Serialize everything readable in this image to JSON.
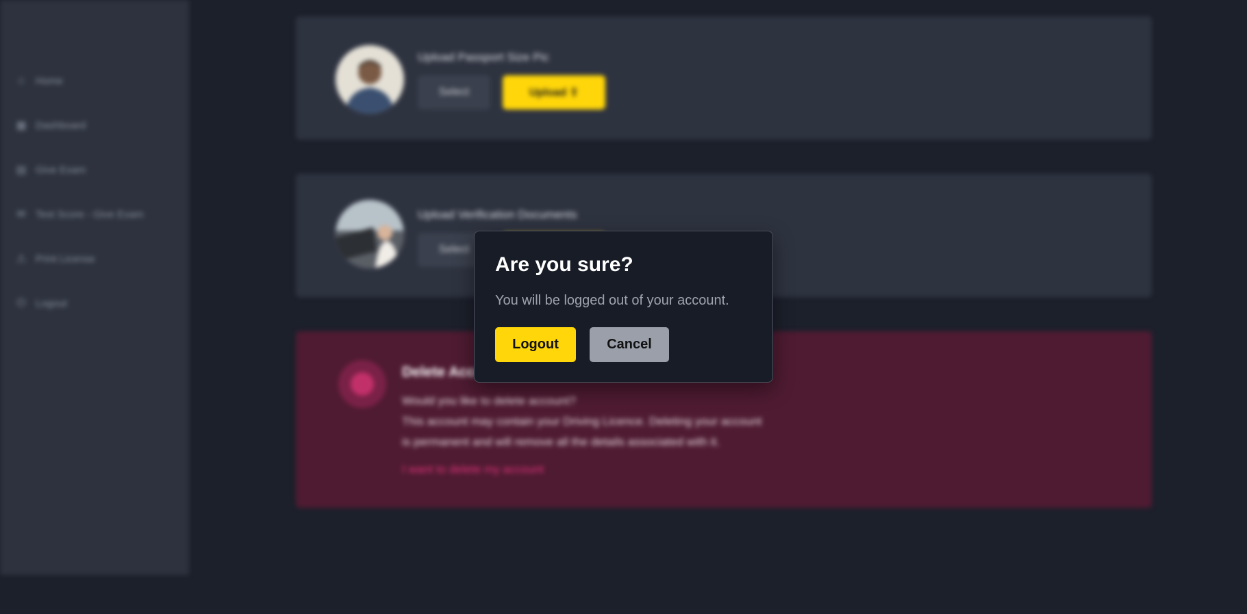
{
  "sidebar": {
    "items": [
      {
        "label": "Home",
        "icon": "home-icon"
      },
      {
        "label": "Dashboard",
        "icon": "dashboard-icon"
      },
      {
        "label": "Give Exam",
        "icon": "exam-icon"
      },
      {
        "label": "Test Score - Give Exam",
        "icon": "score-icon"
      },
      {
        "label": "Print License",
        "icon": "license-icon"
      },
      {
        "label": "Logout",
        "icon": "logout-icon"
      }
    ]
  },
  "passport_card": {
    "title": "Upload Passport Size Pic",
    "select_label": "Select",
    "upload_label": "Upload ⇪"
  },
  "verify_card": {
    "title": "Upload Verification Documents",
    "select_label": "Select"
  },
  "delete_card": {
    "title": "Delete Account",
    "question": "Would you like to delete account?",
    "line1": "This account may contain your Driving Licence. Deleting your account",
    "line2": "is permanent and will remove all the details associated with it.",
    "link": "I want to delete my account"
  },
  "modal": {
    "title": "Are you sure?",
    "message": "You will be logged out of your account.",
    "confirm_label": "Logout",
    "cancel_label": "Cancel"
  },
  "colors": {
    "accent": "#ffd60a",
    "danger_bg": "#4f1b32",
    "danger_link": "#e0327a"
  }
}
